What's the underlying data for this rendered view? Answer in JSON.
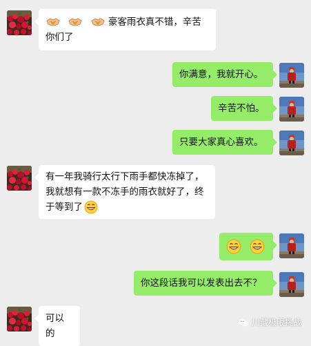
{
  "colors": {
    "background": "#ededed",
    "incoming_bubble": "#ffffff",
    "outgoing_bubble": "#95ec69"
  },
  "messages": [
    {
      "sender": "other",
      "prefix_emoji": [
        "handshake-emoji",
        "handshake-emoji",
        "handshake-emoji"
      ],
      "text": "豪客雨衣真不错，辛苦你们了"
    },
    {
      "sender": "self",
      "text": "你满意，我就开心。"
    },
    {
      "sender": "self",
      "text": "辛苦不怕。"
    },
    {
      "sender": "self",
      "text": "只要大家真心喜欢。"
    },
    {
      "sender": "other",
      "text": "有一年我骑行太行下雨手都快冻掉了，我就想有一款不冻手的雨衣就好了，终于等到了",
      "suffix_emoji": [
        "grin-emoji"
      ]
    },
    {
      "sender": "self",
      "emoji_only": [
        "grin-emoji",
        "grin-emoji"
      ]
    },
    {
      "sender": "self",
      "text": "你这段话我可以发表出去不？"
    },
    {
      "sender": "other",
      "text": "可以的"
    }
  ],
  "watermark": {
    "icon": "wechat-official-account-icon",
    "text": "川藏极限挑战"
  }
}
